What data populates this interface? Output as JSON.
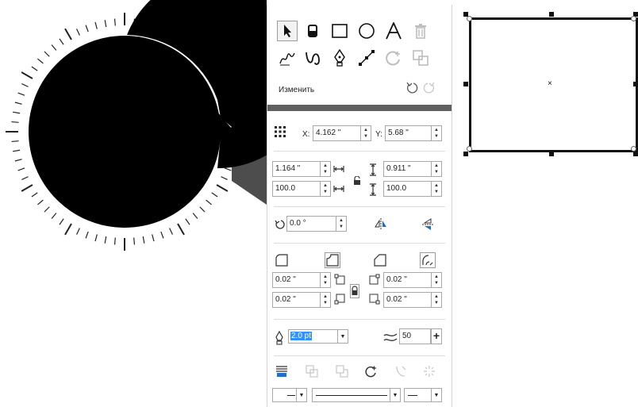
{
  "toolbar": {
    "row1": [
      "pick-tool",
      "eraser-tool",
      "rectangle-tool",
      "ellipse-tool",
      "text-tool",
      "delete-tool"
    ],
    "row2": [
      "freehand-tool",
      "smart-draw-tool",
      "pen-tool",
      "line-tool",
      "contour-tool",
      "shape-tool"
    ]
  },
  "edit": {
    "label": "Изменить"
  },
  "position": {
    "x_label": "X:",
    "x_value": "4.162 \"",
    "y_label": "Y:",
    "y_value": "5.68 \""
  },
  "size": {
    "width_value": "1.164 \"",
    "height_value": "0.911 \"",
    "width_scale": "100.0",
    "height_scale": "100.0"
  },
  "rotation": {
    "value": "0.0 °"
  },
  "corners": {
    "top_left": "0.02 \"",
    "top_right": "0.02 \"",
    "bottom_left": "0.02 \"",
    "bottom_right": "0.02 \""
  },
  "outline": {
    "width": "2.0 pt"
  },
  "smoothing": {
    "value": "50",
    "plus_label": "+"
  },
  "colors": {
    "accent_bar": "#606060",
    "selection": "#3390ff",
    "panel_border": "#d4d4d4"
  }
}
